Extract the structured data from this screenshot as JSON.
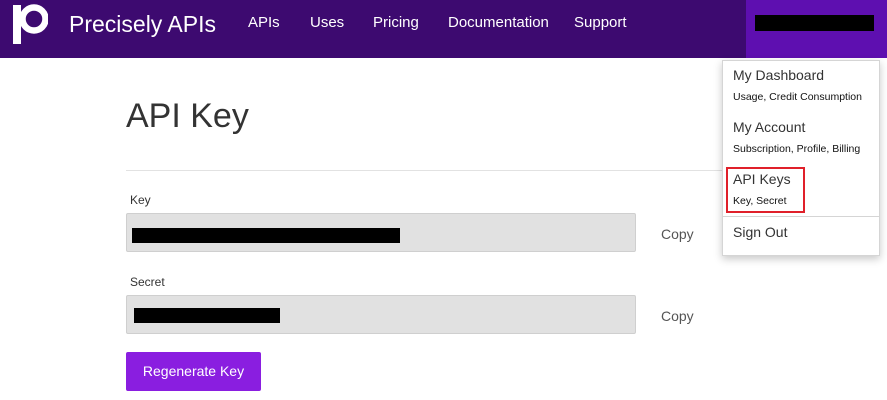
{
  "header": {
    "brand": "Precisely APIs",
    "nav": [
      "APIs",
      "Uses",
      "Pricing",
      "Documentation",
      "Support"
    ],
    "user_name": "[redacted]"
  },
  "main": {
    "title": "API Key",
    "key_label": "Key",
    "key_value": "[redacted]",
    "secret_label": "Secret",
    "secret_value": "[redacted]",
    "copy_label": "Copy",
    "regenerate_label": "Regenerate Key"
  },
  "dropdown": {
    "items": [
      {
        "title": "My Dashboard",
        "subtitle": "Usage, Credit Consumption"
      },
      {
        "title": "My Account",
        "subtitle": "Subscription, Profile, Billing"
      },
      {
        "title": "API Keys",
        "subtitle": "Key, Secret",
        "highlighted": true
      },
      {
        "title": "Sign Out"
      }
    ]
  },
  "colors": {
    "navbar": "#3d0a70",
    "user_toggle": "#5e0fb0",
    "primary_button": "#8a1ee0",
    "highlight": "#e0202a",
    "field_background": "#e1e1e1"
  },
  "icons": [
    "precisely-logo-icon"
  ]
}
